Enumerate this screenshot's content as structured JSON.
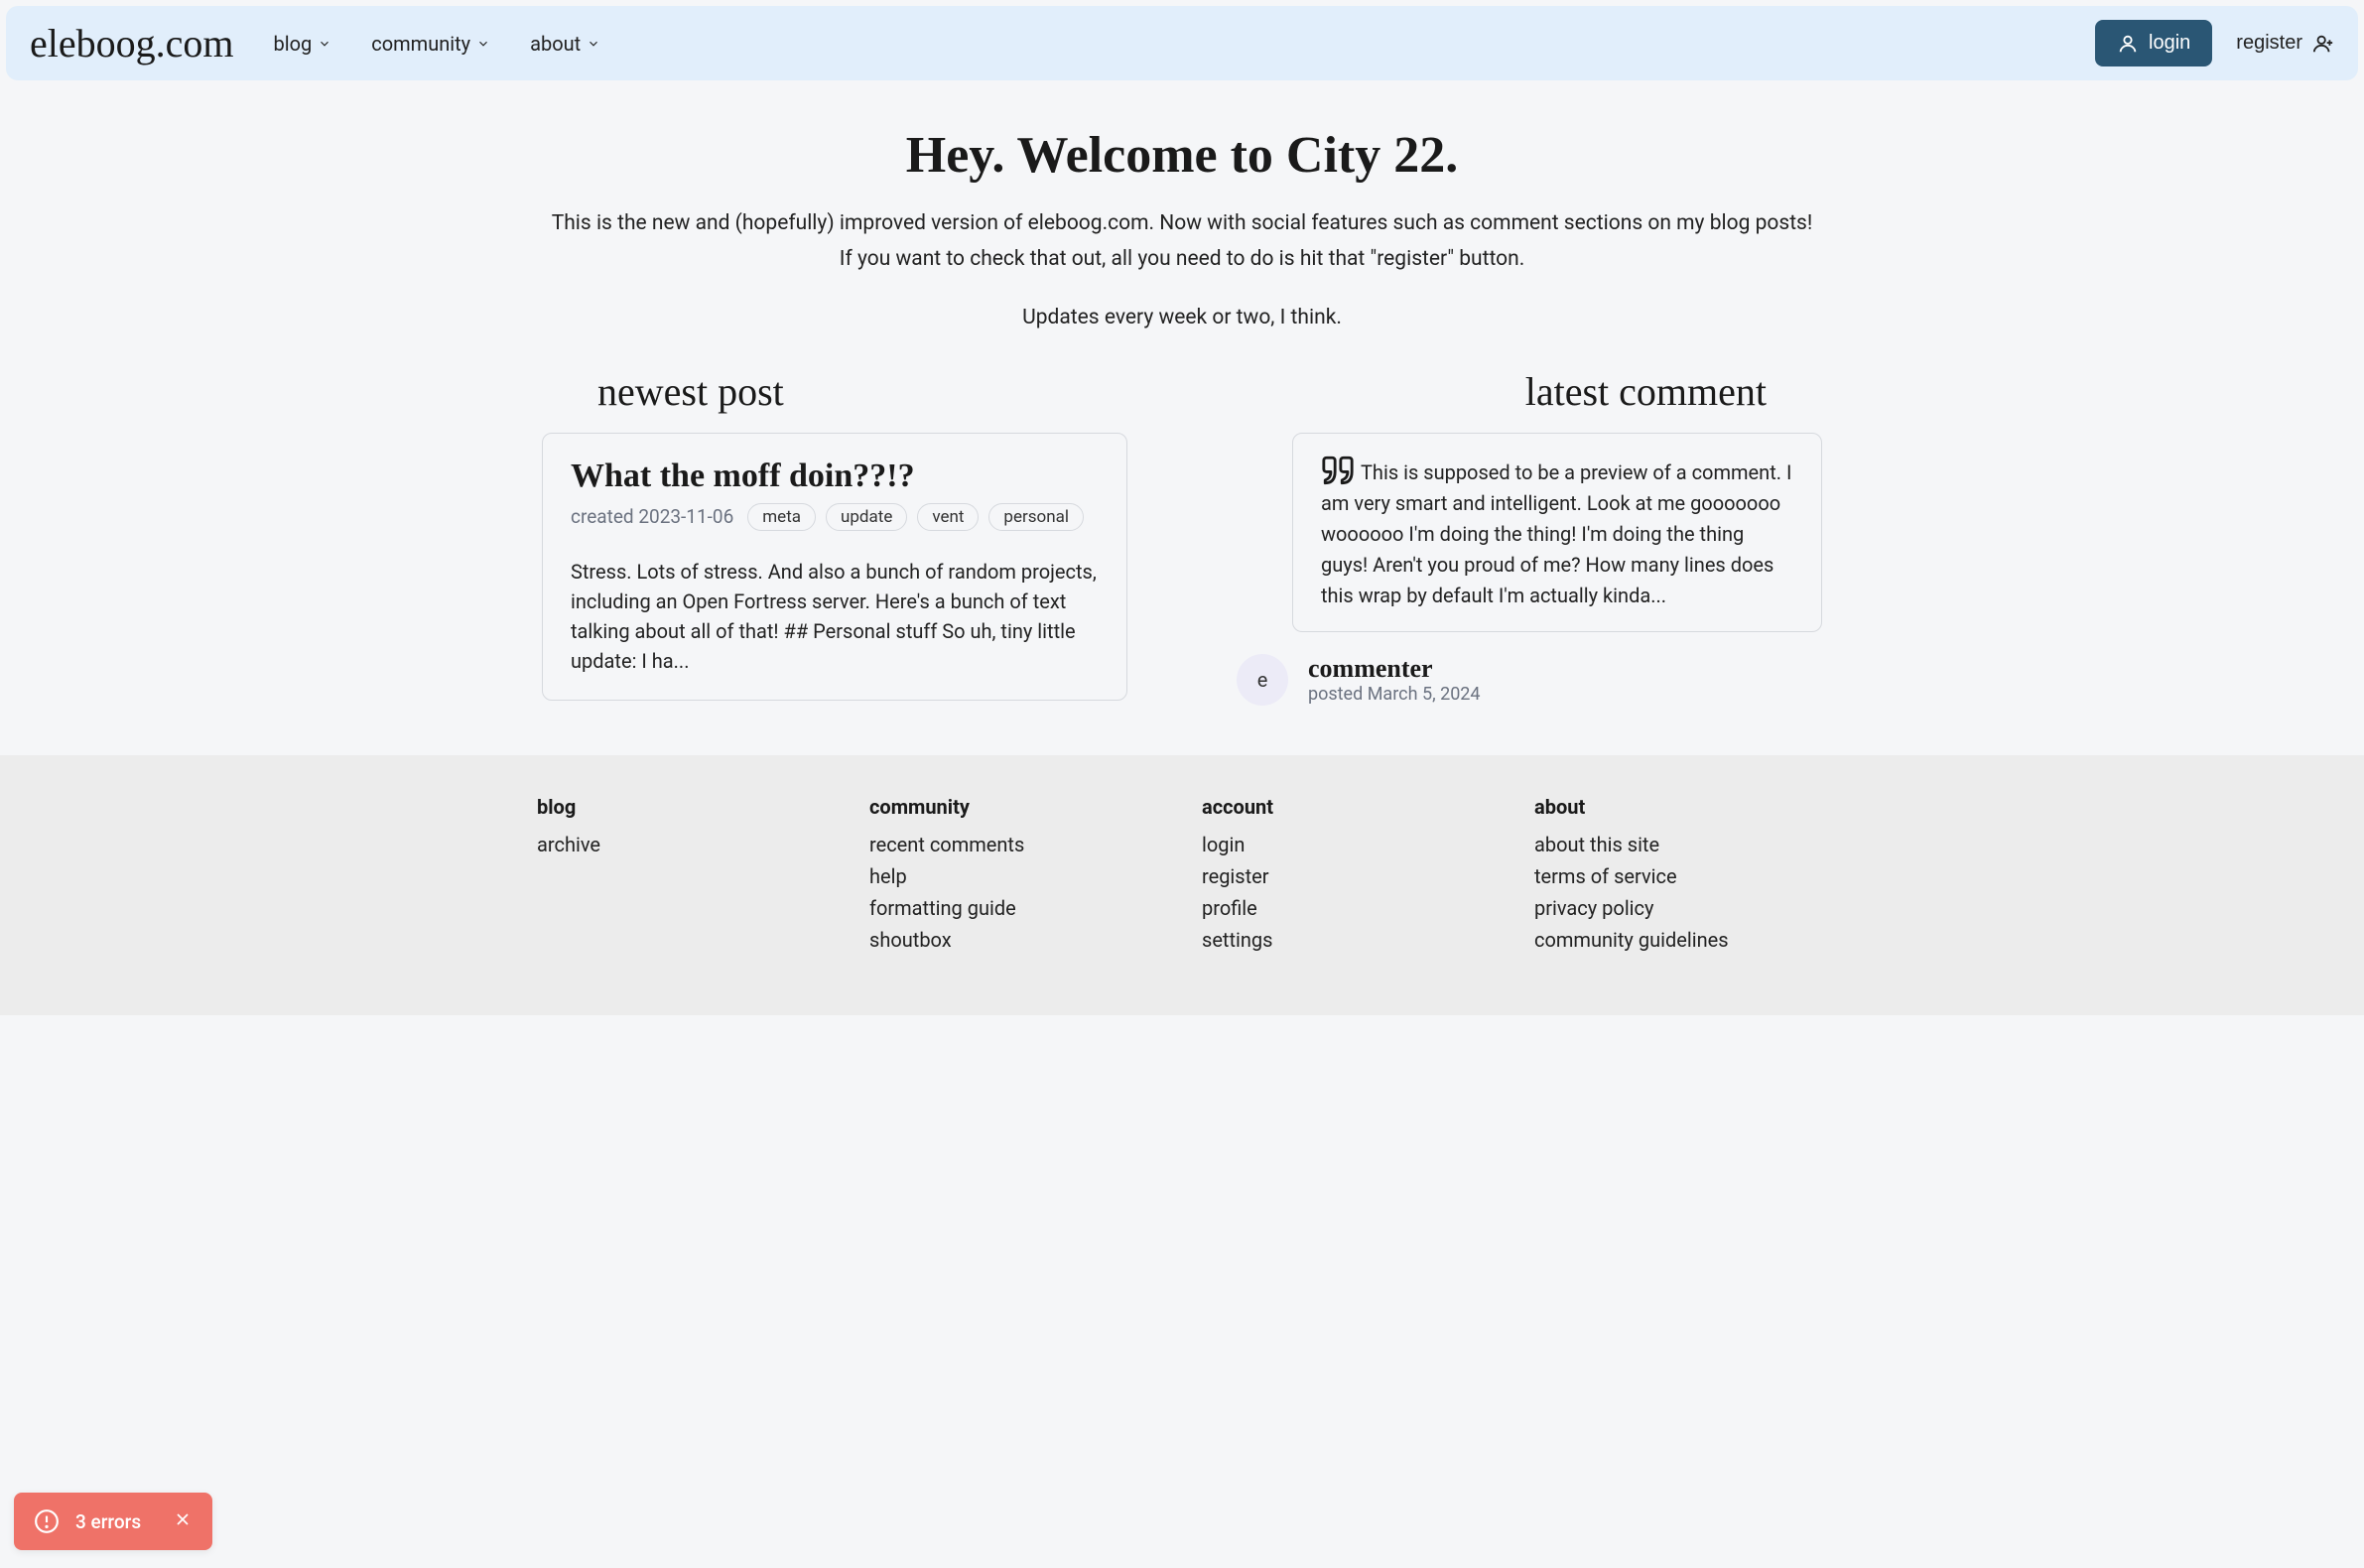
{
  "brand": "eleboog.com",
  "nav": {
    "items": [
      "blog",
      "community",
      "about"
    ],
    "login": "login",
    "register": "register"
  },
  "hero": {
    "title": "Hey. Welcome to City 22.",
    "line1": "This is the new and (hopefully) improved version of eleboog.com. Now with social features such as comment sections on my blog posts!",
    "line2": "If you want to check that out, all you need to do is hit that \"register\" button.",
    "updates": "Updates every week or two, I think."
  },
  "sections": {
    "newest_post": "newest post",
    "latest_comment": "latest comment"
  },
  "post": {
    "title": "What the moff doin??!?",
    "created": "created 2023-11-06",
    "tags": [
      "meta",
      "update",
      "vent",
      "personal"
    ],
    "excerpt": "Stress. Lots of stress. And also a bunch of random projects, including an Open Fortress server. Here's a bunch of text talking about all of that! ## Personal stuff So uh, tiny little update: I ha..."
  },
  "comment": {
    "body": "This is supposed to be a preview of a comment. I am very smart and intelligent. Look at me gooooooo woooooo I'm doing the thing! I'm doing the thing guys! Aren't you proud of me? How many lines does this wrap by default I'm actually kinda...",
    "avatar_initial": "e",
    "author": "commenter",
    "date": "posted March 5, 2024"
  },
  "footer": {
    "blog": {
      "heading": "blog",
      "links": [
        "archive"
      ]
    },
    "community": {
      "heading": "community",
      "links": [
        "recent comments",
        "help",
        "formatting guide",
        "shoutbox"
      ]
    },
    "account": {
      "heading": "account",
      "links": [
        "login",
        "register",
        "profile",
        "settings"
      ]
    },
    "about": {
      "heading": "about",
      "links": [
        "about this site",
        "terms of service",
        "privacy policy",
        "community guidelines"
      ]
    }
  },
  "toast": {
    "text": "3 errors"
  }
}
